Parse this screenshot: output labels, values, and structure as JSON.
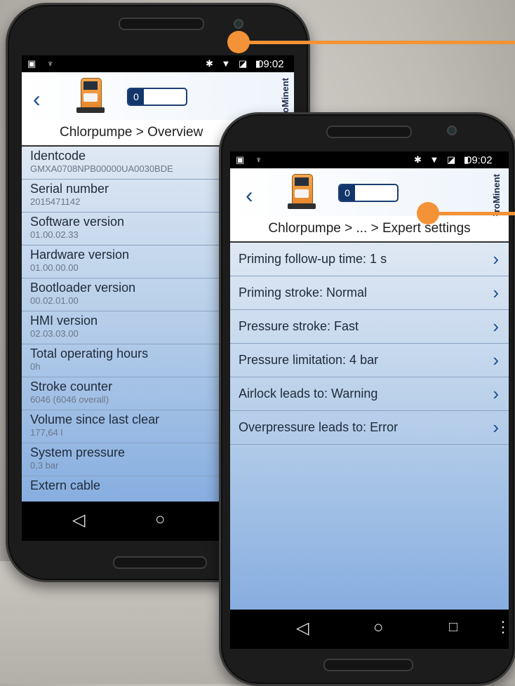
{
  "colors": {
    "accent": "#f39236",
    "nav_blue": "#1b4d8c"
  },
  "phone_left": {
    "status": {
      "time": "09:02"
    },
    "counter_value": "0",
    "brand": "ProMinent",
    "breadcrumb": "Chlorpumpe > Overview",
    "items": [
      {
        "title": "Identcode",
        "value": "GMXA0708NPB00000UA0030BDE"
      },
      {
        "title": "Serial number",
        "value": "2015471142"
      },
      {
        "title": "Software version",
        "value": "01.00.02.33"
      },
      {
        "title": "Hardware version",
        "value": "01.00.00.00"
      },
      {
        "title": "Bootloader version",
        "value": "00.02.01.00"
      },
      {
        "title": "HMI version",
        "value": "02.03.03.00"
      },
      {
        "title": "Total operating hours",
        "value": "0h"
      },
      {
        "title": "Stroke counter",
        "value": "6046 (6046 overall)"
      },
      {
        "title": "Volume since last clear",
        "value": "177,64 l"
      },
      {
        "title": "System pressure",
        "value": "0,3 bar"
      },
      {
        "title": "Extern cable",
        "value": ""
      }
    ]
  },
  "phone_right": {
    "status": {
      "time": "09:02"
    },
    "counter_value": "0",
    "brand": "ProMinent",
    "breadcrumb": "Chlorpumpe > ... > Expert settings",
    "items": [
      {
        "title": "Priming follow-up time: 1 s"
      },
      {
        "title": "Priming stroke: Normal"
      },
      {
        "title": "Pressure stroke: Fast"
      },
      {
        "title": "Pressure limitation: 4 bar"
      },
      {
        "title": "Airlock leads to: Warning"
      },
      {
        "title": "Overpressure leads to: Error"
      }
    ]
  },
  "icons": {
    "back": "chevron-left-icon",
    "chevron": "chevron-right-icon",
    "nav_back": "nav-back-icon",
    "nav_home": "nav-home-icon",
    "nav_recents": "nav-recents-icon",
    "nav_menu": "overflow-menu-icon"
  }
}
